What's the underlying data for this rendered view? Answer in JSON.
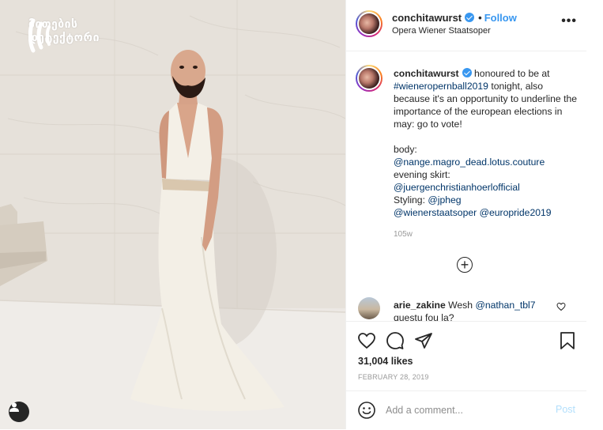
{
  "watermark": {
    "line1": "მითების",
    "line2": "დეტექტორი"
  },
  "post_header": {
    "username": "conchitawurst",
    "dot": "•",
    "follow_label": "Follow",
    "location": "Opera Wiener Staatsoper",
    "more_label": "•••"
  },
  "caption": {
    "username": "conchitawurst",
    "text_before_tag": "honoured to be at",
    "hashtag": "#wieneropernball2019",
    "text_after_tag": "tonight, also because it's an opportunity to underline the importance of the european elections in may: go to vote!",
    "body_label": "body:",
    "body_tags": "@nange.magro_dead.lotus.couture",
    "skirt_label": "evening skirt:",
    "skirt_tag": "@juergenchristianhoerlofficial",
    "styling_label": "Styling:",
    "styling_tag": "@jpheg",
    "venue_tag": "@wienerstaatsoper",
    "pride_tag": "@europride2019",
    "time_ago": "105w"
  },
  "load_more": "+",
  "comment": {
    "username": "arie_zakine",
    "text_before": "Wesh",
    "mention": "@nathan_tbl7",
    "text_after": "questu fou la?"
  },
  "actions": {
    "icons": [
      "heart-icon",
      "comment-icon",
      "share-icon",
      "bookmark-icon"
    ]
  },
  "likes": "31,004 likes",
  "date": "FEBRUARY 28, 2019",
  "comment_box": {
    "placeholder": "Add a comment...",
    "post_label": "Post"
  },
  "colors": {
    "link": "#003569",
    "follow": "#3897f0",
    "post_disabled": "#b2dffc",
    "muted": "#999999"
  }
}
